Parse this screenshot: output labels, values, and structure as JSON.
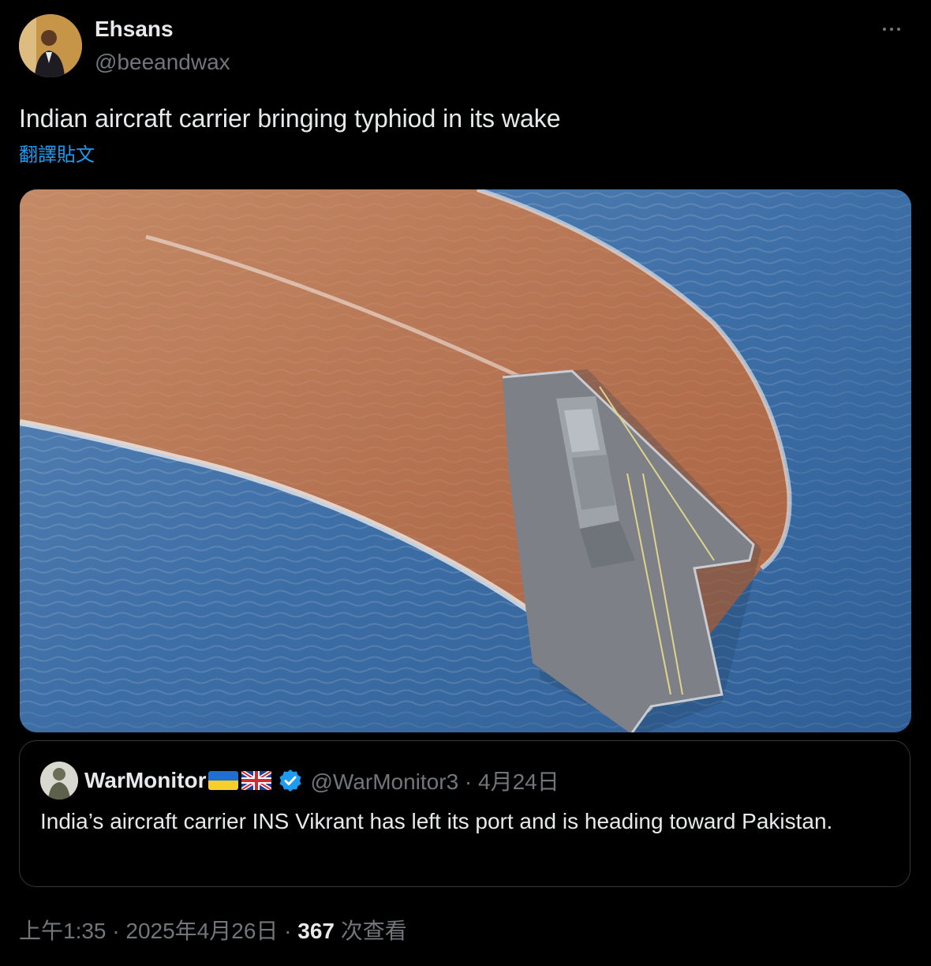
{
  "author": {
    "display_name": "Ehsans",
    "handle": "@beeandwax",
    "avatar_icon": "profile-photo"
  },
  "tweet": {
    "text": "Indian aircraft carrier bringing typhiod in its wake",
    "translate_label": "翻譯貼文",
    "more_icon": "more-options-icon"
  },
  "media": {
    "image_subject": "aircraft-carrier-with-brown-wake-on-ocean"
  },
  "quote": {
    "display_name": "WarMonitor",
    "flags": [
      "ukraine-flag-icon",
      "uk-flag-icon"
    ],
    "verified_icon": "verified-badge-icon",
    "handle_and_date": "@WarMonitor3 · 4月24日",
    "text": "India’s aircraft carrier INS Vikrant has left its port and is heading toward Pakistan."
  },
  "meta": {
    "time_date": "上午1:35 · 2025年4月26日 · ",
    "view_count": "367",
    "view_label": " 次查看"
  },
  "colors": {
    "background": "#000000",
    "text_primary": "#e7e9ea",
    "text_secondary": "#71767b",
    "link": "#1d9bf0",
    "border": "#333639"
  }
}
